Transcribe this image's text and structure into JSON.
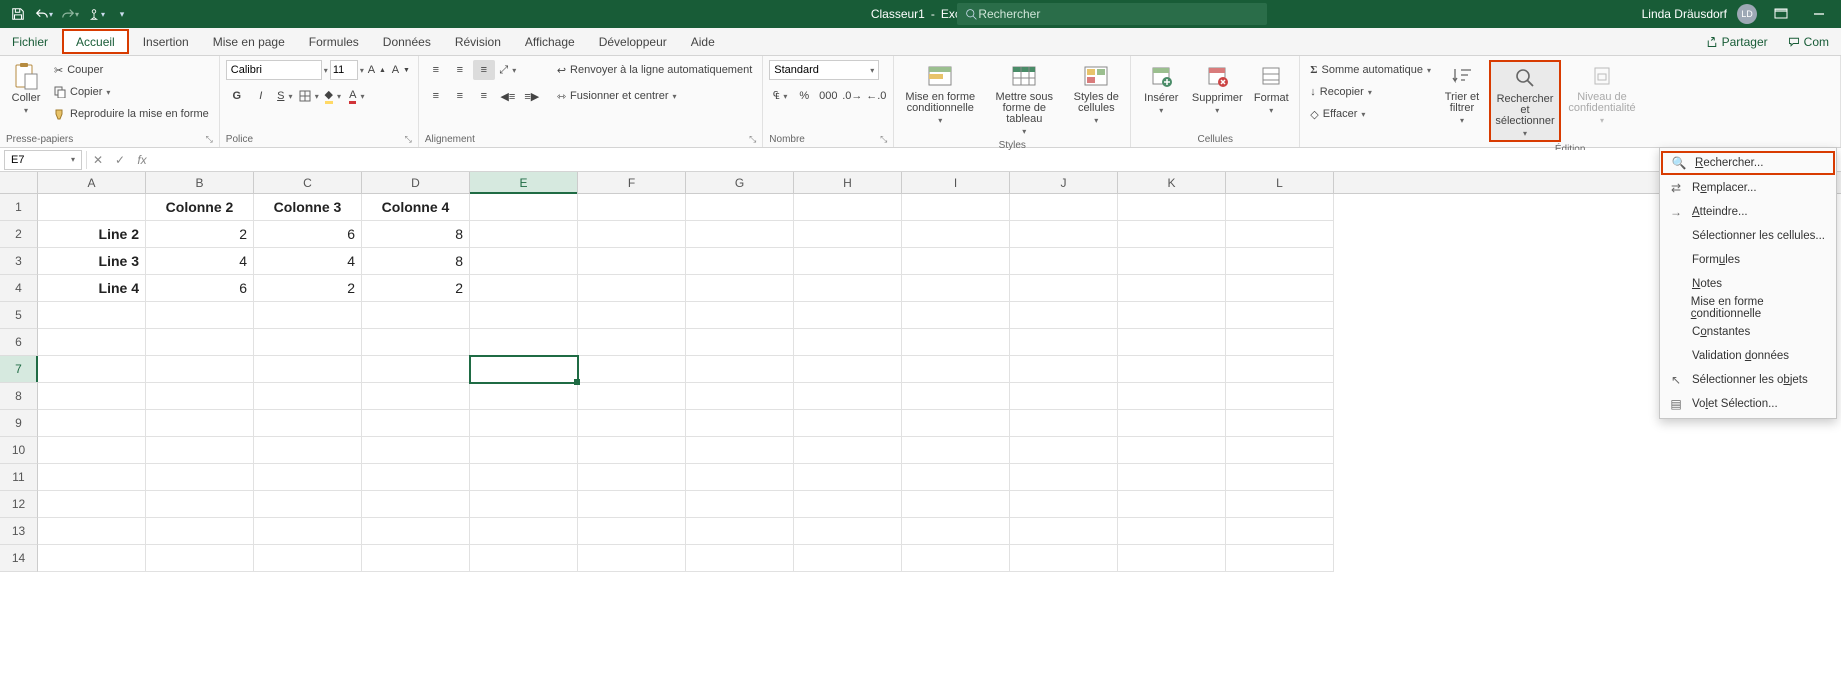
{
  "title": {
    "doc": "Classeur1",
    "app": "Excel"
  },
  "search": {
    "placeholder": "Rechercher"
  },
  "user": {
    "name": "Linda Dräusdorf",
    "initials": "LD"
  },
  "tabs": {
    "file": "Fichier",
    "home": "Accueil",
    "insert": "Insertion",
    "layout": "Mise en page",
    "formulas": "Formules",
    "data": "Données",
    "review": "Révision",
    "view": "Affichage",
    "developer": "Développeur",
    "help": "Aide"
  },
  "share": {
    "share": "Partager",
    "comments": "Com"
  },
  "ribbon": {
    "clipboard": {
      "paste": "Coller",
      "cut": "Couper",
      "copy": "Copier",
      "painter": "Reproduire la mise en forme",
      "label": "Presse-papiers"
    },
    "font": {
      "name": "Calibri",
      "size": "11",
      "bold": "G",
      "italic": "I",
      "underline": "S",
      "label": "Police"
    },
    "alignment": {
      "wrap": "Renvoyer à la ligne automatiquement",
      "merge": "Fusionner et centrer",
      "label": "Alignement"
    },
    "number": {
      "format": "Standard",
      "label": "Nombre"
    },
    "styles": {
      "cond": "Mise en forme conditionnelle",
      "table": "Mettre sous forme de tableau",
      "cellstyles": "Styles de cellules",
      "label": "Styles"
    },
    "cells": {
      "insert": "Insérer",
      "delete": "Supprimer",
      "format": "Format",
      "label": "Cellules"
    },
    "editing": {
      "autosum": "Somme automatique",
      "fill": "Recopier",
      "clear": "Effacer",
      "sort": "Trier et filtrer",
      "find": "Rechercher et sélectionner",
      "sensitivity": "Niveau de confidentialité",
      "label": "Édition"
    }
  },
  "findmenu": {
    "find": "Rechercher...",
    "replace": "Remplacer...",
    "goto": "Atteindre...",
    "special": "Sélectionner les cellules...",
    "formulas": "Formules",
    "notes": "Notes",
    "cond": "Mise en forme conditionnelle",
    "constants": "Constantes",
    "validation": "Validation données",
    "objects": "Sélectionner les objets",
    "pane": "Volet Sélection..."
  },
  "fbar": {
    "ref": "E7",
    "formula": ""
  },
  "cols": [
    "A",
    "B",
    "C",
    "D",
    "E",
    "F",
    "G",
    "H",
    "I",
    "J",
    "K",
    "L"
  ],
  "rows": 14,
  "headers": {
    "b": "Colonne 2",
    "c": "Colonne 3",
    "d": "Colonne 4"
  },
  "data": {
    "a2": "Line 2",
    "b2": "2",
    "c2": "6",
    "d2": "8",
    "a3": "Line 3",
    "b3": "4",
    "c3": "4",
    "d3": "8",
    "a4": "Line 4",
    "b4": "6",
    "c4": "2",
    "d4": "2"
  },
  "selected": {
    "col": "E",
    "row": 7
  }
}
